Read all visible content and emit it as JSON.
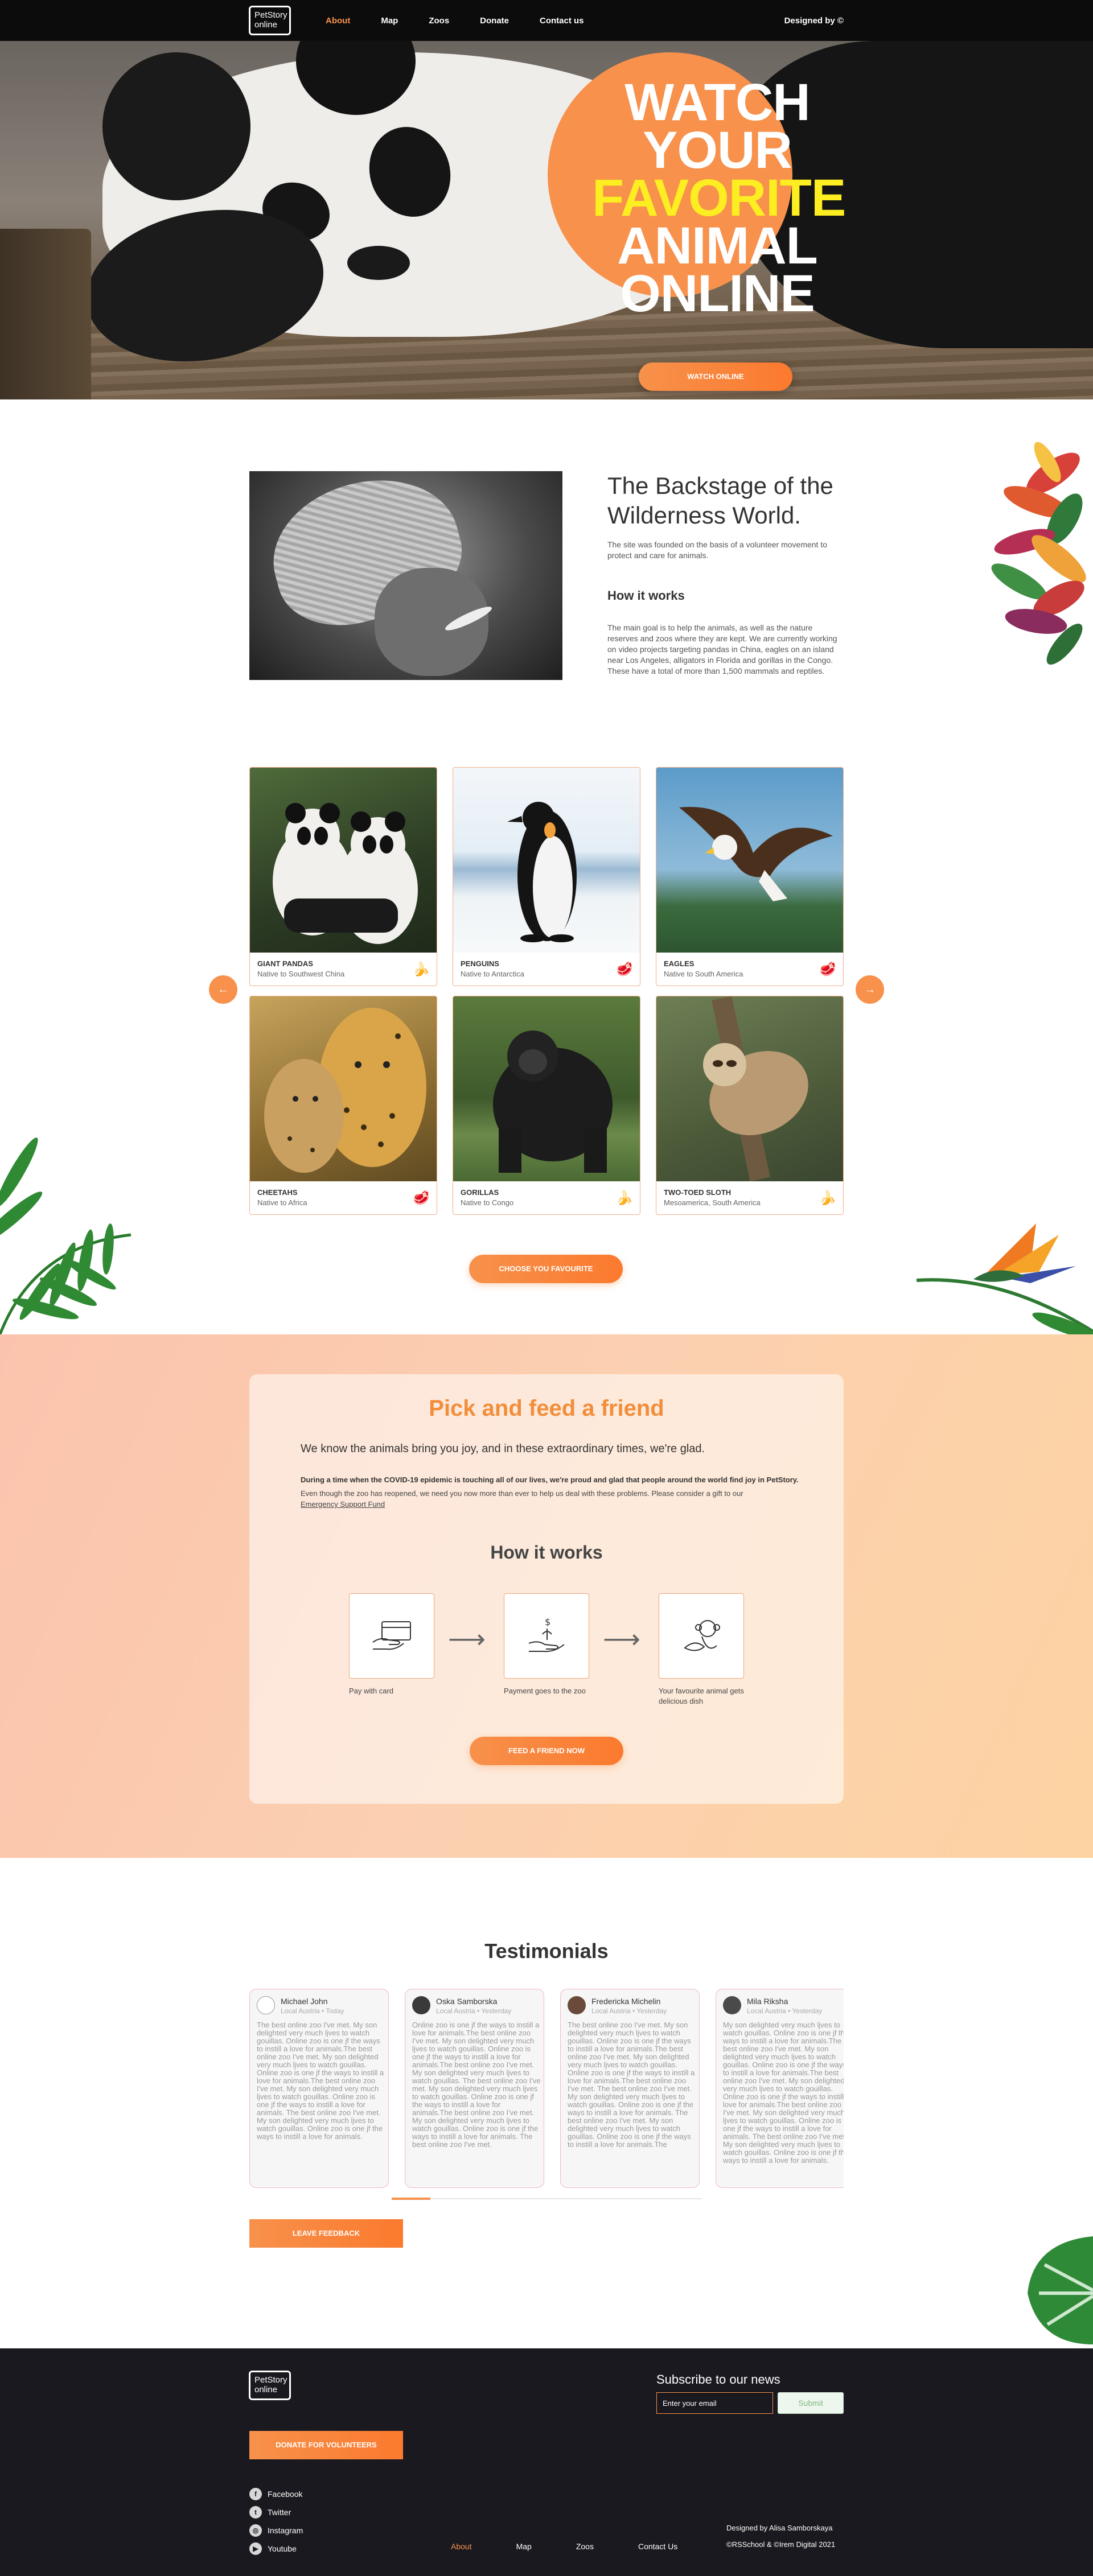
{
  "header": {
    "logo_line1": "PetStory",
    "logo_line2": "online",
    "nav": [
      "About",
      "Map",
      "Zoos",
      "Donate",
      "Contact us"
    ],
    "designed_by": "Designed by ©"
  },
  "hero": {
    "line1": "WATCH",
    "line2": "YOUR",
    "line3": "FAVORITE",
    "line4": "ANIMAL",
    "line5": "ONLINE",
    "button": "WATCH ONLINE",
    "accent_color": "#f7914b",
    "highlight_color": "#fcee21"
  },
  "about": {
    "title": "The Backstage of the Wilderness World.",
    "text": "The site was founded on the basis of a volunteer movement to protect and care for animals.",
    "subtitle": "How it works",
    "text2": "The main goal is to help the animals, as well as the nature reserves and zoos where they are kept. We are currently working on video projects targeting pandas in China, eagles on an island near Los Angeles, alligators in Florida and gorillas in the Congo. These have a total of more than 1,500 mammals and reptiles."
  },
  "animals": {
    "prev_icon": "←",
    "next_icon": "→",
    "items": [
      {
        "name": "GIANT PANDAS",
        "origin": "Native to Southwest China",
        "food": "banana-icon"
      },
      {
        "name": "PENGUINS",
        "origin": "Native to Antarctica",
        "food": "meat-icon"
      },
      {
        "name": "EAGLES",
        "origin": "Native to South America",
        "food": "meat-icon"
      },
      {
        "name": "CHEETAHS",
        "origin": "Native to Africa",
        "food": "meat-icon"
      },
      {
        "name": "GORILLAS",
        "origin": "Native to Congo",
        "food": "banana-icon"
      },
      {
        "name": "TWO-TOED SLOTH",
        "origin": "Mesoamerica, South America",
        "food": "banana-icon"
      }
    ],
    "button": "CHOOSE YOU FAVOURITE"
  },
  "feed": {
    "title": "Pick and feed a friend",
    "lead": "We know the animals bring you joy, and in these extraordinary times, we're glad.",
    "bold": "During a time when the COVID-19 epidemic is touching all of our lives, we're proud and glad that people around the world find joy in PetStory.",
    "small": "Even though the zoo has reopened, we need you now more than ever to help us deal with these problems. Please consider a gift to our",
    "link": "Emergency Support Fund",
    "how_title": "How it works",
    "steps": [
      "Pay with card",
      "Payment goes to the zoo",
      "Your favourite animal gets delicious dish"
    ],
    "button": "FEED A FRIEND NOW"
  },
  "testimonials": {
    "title": "Testimonials",
    "items": [
      {
        "name": "Michael John",
        "location": "Local Austria",
        "when": "Today",
        "text": "The best online zoo I've met. My son delighted very much ljves to watch gouillas. Online zoo is one jf the ways to instill a love for animals.The best online zoo I've met. My son delighted very much ljves to watch gouillas. Online zoo is one jf the ways to instill a love for animals.The best online zoo I've met. My son delighted very much ljves to watch gouillas. Online zoo is one jf the ways to instill a love for animals. The best online zoo I've met. My son delighted very much ljves to watch gouillas. Online zoo is one jf the ways to instill a love for animals."
      },
      {
        "name": "Oska Samborska",
        "location": "Local Austria",
        "when": "Yesterday",
        "text": "Online zoo is one jf the ways to instill a love for animals.The best online zoo I've met. My son delighted very much ljves to watch gouillas. Online zoo is one jf the ways to instill a love for animals.The best online zoo I've met. My son delighted very much ljves to watch gouillas. The best online zoo I've met. My son delighted very much ljves to watch gouillas. Online zoo is one jf the ways to instill a love for animals.The best online zoo I've met. My son delighted very much ljves to watch gouillas. Online zoo is one jf the ways to instill a love for animals. The best online zoo I've met."
      },
      {
        "name": "Fredericka Michelin",
        "location": "Local Austria",
        "when": "Yesterday",
        "text": "The best online zoo I've met. My son delighted very much ljves to watch gouillas. Online zoo is one jf the ways to instill a love for animals.The best online zoo I've met. My son delighted very much ljves to watch gouillas. Online zoo is one jf the ways to instill a love for animals.The best online zoo I've met. The best online zoo I've met. My son delighted very much ljves to watch gouillas. Online zoo is one jf the ways to instill a love for animals. The best online zoo I've met. My son delighted very much ljves to watch gouillas. Online zoo is one jf the ways to instill a love for animals.The"
      },
      {
        "name": "Mila Riksha",
        "location": "Local Austria",
        "when": "Yesterday",
        "text": "My son delighted very much ljves to watch gouillas. Online zoo is one jf the ways to instill a love for animals.The best online zoo I've met. My son delighted very much ljves to watch gouillas. Online zoo is one jf the ways to instill a love for animals.The best online zoo I've met. My son delighted very much ljves to watch gouillas. Online zoo is one jf the ways to instill a love for animals.The best online zoo I've met. My son delighted very much ljves to watch gouillas. Online zoo is one jf the ways to instill a love for animals. The best online zoo I've met. My son delighted very much ljves to watch gouillas. Online zoo is one jf the ways to instill a love for animals."
      }
    ],
    "button": "LEAVE FEEDBACK"
  },
  "footer": {
    "logo_line1": "PetStory",
    "logo_line2": "online",
    "subscribe_title": "Subscribe to our news",
    "email_placeholder": "Enter your email",
    "submit": "Submit",
    "donate": "DONATE FOR VOLUNTEERS",
    "social": [
      {
        "label": "Facebook",
        "glyph": "f"
      },
      {
        "label": "Twitter",
        "glyph": "t"
      },
      {
        "label": "Instagram",
        "glyph": "◎"
      },
      {
        "label": "Youtube",
        "glyph": "▶"
      }
    ],
    "nav": [
      "About",
      "Map",
      "Zoos",
      "Contact Us"
    ],
    "credit1": "Designed by Alisa Samborskaya",
    "credit2": "©RSSchool & ©Irem Digital 2021"
  }
}
